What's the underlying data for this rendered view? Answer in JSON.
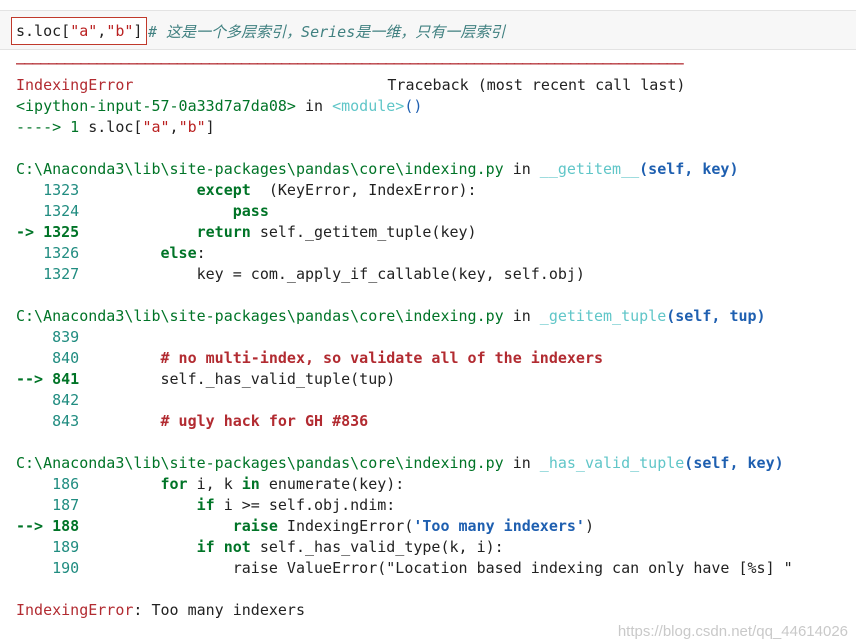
{
  "cell": {
    "code_prefix": "s.loc[",
    "arg_a": "\"a\"",
    "comma": ",",
    "arg_b": "\"b\"",
    "code_suffix": "]",
    "comment": "# 这是一个多层索引，Series是一维，只有一层索引"
  },
  "traceback": {
    "separator": "───────────────────────────────────────────────────────────────────────────────────",
    "error_name": "IndexingError",
    "header_right": "Traceback (most recent call last)",
    "input_ref": "<ipython-input-57-0a33d7a7da08>",
    "in_word": " in ",
    "module": "<module>",
    "paren": "()",
    "arrow1": "---->",
    "line1_num": " 1 ",
    "line1_code_a": "s.loc[",
    "line1_str_a": "\"a\"",
    "line1_comma": ",",
    "line1_str_b": "\"b\"",
    "line1_end": "]",
    "frames": [
      {
        "path": "C:\\Anaconda3\\lib\\site-packages\\pandas\\core\\indexing.py",
        "in": " in ",
        "func": "__getitem__",
        "args": "(self, key)",
        "lines": [
          {
            "marker": "   ",
            "num": "1323",
            "indent": "            ",
            "parts": [
              [
                "bold green",
                "except"
              ],
              [
                "",
                "  (KeyError, IndexError):"
              ]
            ]
          },
          {
            "marker": "   ",
            "num": "1324",
            "indent": "                ",
            "parts": [
              [
                "bold green",
                "pass"
              ]
            ]
          },
          {
            "marker": "-> ",
            "num": "1325",
            "indent": "            ",
            "active": true,
            "parts": [
              [
                "bold green",
                "return"
              ],
              [
                "",
                " self._getitem_tuple(key)"
              ]
            ]
          },
          {
            "marker": "   ",
            "num": "1326",
            "indent": "        ",
            "parts": [
              [
                "bold green",
                "else"
              ],
              [
                "",
                ":"
              ]
            ]
          },
          {
            "marker": "   ",
            "num": "1327",
            "indent": "            ",
            "parts": [
              [
                "",
                "key = com._apply_if_callable(key, self.obj)"
              ]
            ]
          }
        ]
      },
      {
        "path": "C:\\Anaconda3\\lib\\site-packages\\pandas\\core\\indexing.py",
        "in": " in ",
        "func": "_getitem_tuple",
        "args": "(self, tup)",
        "lines": [
          {
            "marker": "    ",
            "num": "839",
            "indent": "",
            "parts": []
          },
          {
            "marker": "    ",
            "num": "840",
            "indent": "        ",
            "parts": [
              [
                "bold red",
                "# no multi-index, so validate all of the indexers"
              ]
            ]
          },
          {
            "marker": "--> ",
            "num": "841",
            "indent": "        ",
            "active": true,
            "parts": [
              [
                "",
                "self._has_valid_tuple(tup)"
              ]
            ]
          },
          {
            "marker": "    ",
            "num": "842",
            "indent": "",
            "parts": []
          },
          {
            "marker": "    ",
            "num": "843",
            "indent": "        ",
            "parts": [
              [
                "bold red",
                "# ugly hack for GH #836"
              ]
            ]
          }
        ]
      },
      {
        "path": "C:\\Anaconda3\\lib\\site-packages\\pandas\\core\\indexing.py",
        "in": " in ",
        "func": "_has_valid_tuple",
        "args": "(self, key)",
        "lines": [
          {
            "marker": "    ",
            "num": "186",
            "indent": "        ",
            "parts": [
              [
                "bold green",
                "for"
              ],
              [
                "",
                " i, k "
              ],
              [
                "bold green",
                "in"
              ],
              [
                "",
                " enumerate(key):"
              ]
            ]
          },
          {
            "marker": "    ",
            "num": "187",
            "indent": "            ",
            "parts": [
              [
                "bold green",
                "if"
              ],
              [
                "",
                " i >= self.obj.ndim:"
              ]
            ]
          },
          {
            "marker": "--> ",
            "num": "188",
            "indent": "                ",
            "active": true,
            "parts": [
              [
                "bold green",
                "raise"
              ],
              [
                "",
                " IndexingError("
              ],
              [
                "bold blue",
                "'Too many indexers'"
              ],
              [
                "",
                ")"
              ]
            ]
          },
          {
            "marker": "    ",
            "num": "189",
            "indent": "            ",
            "parts": [
              [
                "bold green",
                "if"
              ],
              [
                "bold green",
                " not"
              ],
              [
                "",
                " self._has_valid_type(k, i):"
              ]
            ]
          },
          {
            "marker": "    ",
            "num": "190",
            "indent": "                ",
            "parts": [
              [
                "",
                "raise ValueError(\"Location based indexing can only have [%s] \""
              ]
            ]
          }
        ]
      }
    ],
    "final_error_name": "IndexingError",
    "final_error_msg": ": Too many indexers"
  },
  "watermark": "https://blog.csdn.net/qq_44614026"
}
